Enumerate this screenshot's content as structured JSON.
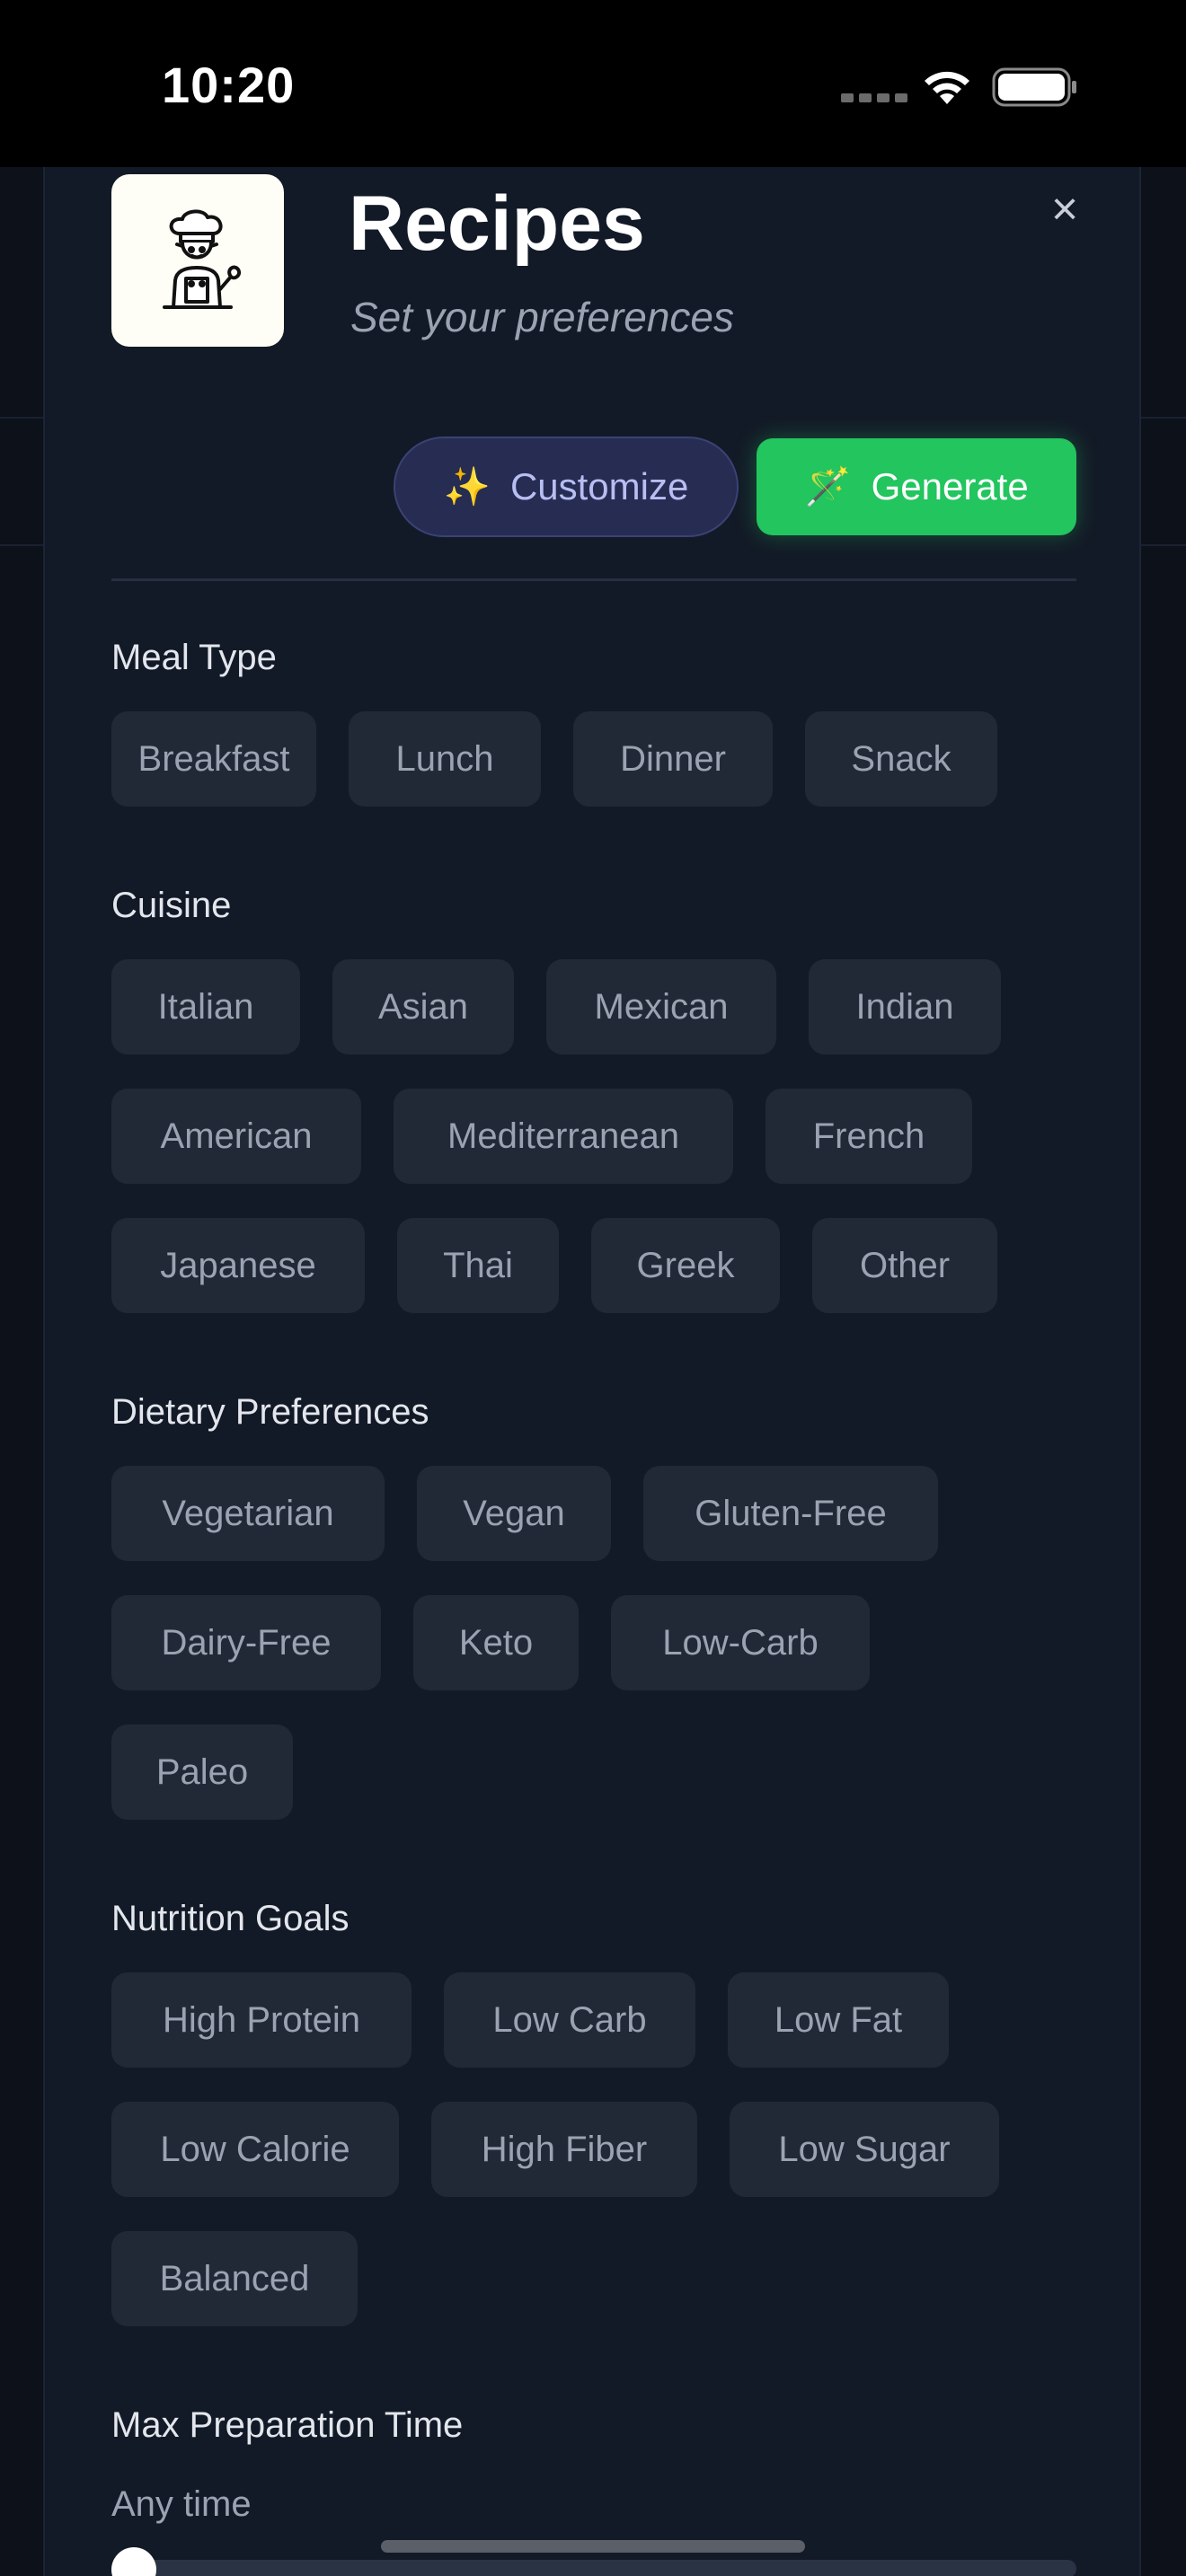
{
  "status_bar": {
    "time": "10:20"
  },
  "header": {
    "title": "Recipes",
    "subtitle": "Set your preferences",
    "close_label": "×"
  },
  "actions": {
    "customize_icon": "✨",
    "customize_label": "Customize",
    "generate_icon": "🪄",
    "generate_label": "Generate"
  },
  "meal_type": {
    "label": "Meal Type",
    "options": [
      "Breakfast",
      "Lunch",
      "Dinner",
      "Snack"
    ]
  },
  "cuisine": {
    "label": "Cuisine",
    "options": [
      "Italian",
      "Asian",
      "Mexican",
      "Indian",
      "American",
      "Mediterranean",
      "French",
      "Japanese",
      "Thai",
      "Greek",
      "Other"
    ]
  },
  "dietary": {
    "label": "Dietary Preferences",
    "options": [
      "Vegetarian",
      "Vegan",
      "Gluten-Free",
      "Dairy-Free",
      "Keto",
      "Low-Carb",
      "Paleo"
    ]
  },
  "nutrition": {
    "label": "Nutrition Goals",
    "options": [
      "High Protein",
      "Low Carb",
      "Low Fat",
      "Low Calorie",
      "High Fiber",
      "Low Sugar",
      "Balanced"
    ]
  },
  "prep_time": {
    "label": "Max Preparation Time",
    "value_label": "Any time",
    "slider_value": 0
  },
  "colors": {
    "sheet_bg": "#131a27",
    "chip_bg": "#212937",
    "generate_bg": "#22c55e",
    "customize_bg": "#262c52"
  }
}
